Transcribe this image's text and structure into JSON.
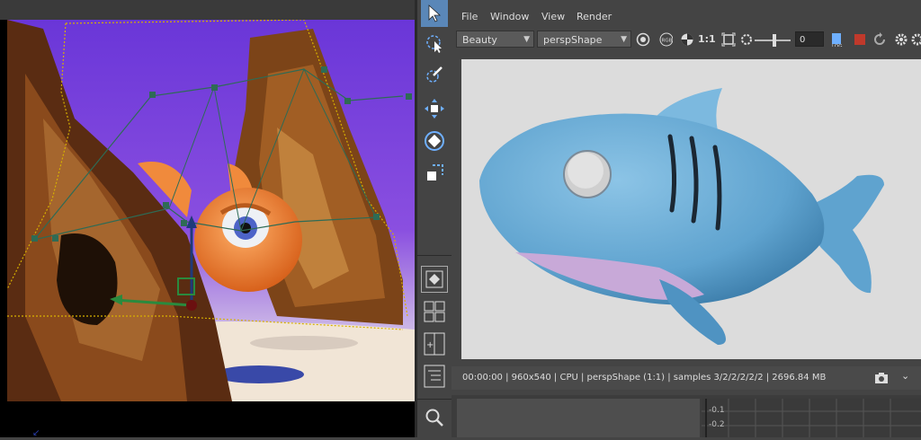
{
  "menu": {
    "file": "File",
    "window": "Window",
    "view": "View",
    "render": "Render"
  },
  "toolbar": {
    "aov_select": "Beauty",
    "camera_select": "perspShape",
    "ratio_label": "1:1",
    "exposure_value": "0"
  },
  "statusbar": {
    "text": "00:00:00 | 960x540 | CPU | perspShape (1:1) | samples 3/2/2/2/2/2 | 2696.84 MB"
  },
  "graph": {
    "tick_1": "-0.1",
    "tick_2": "-0.2"
  },
  "colors": {
    "accent_selected": "#5a87b8",
    "panel_bg": "#444444",
    "render_bg": "#dcdcdc",
    "shark_blue": "#5fa3cf",
    "fish_orange": "#f08a3c",
    "scene_purple": "#7b3dd6"
  },
  "icons": [
    "select-tool-icon",
    "lasso-tool-icon",
    "paint-select-icon",
    "move-tool-icon",
    "rotate-tool-icon",
    "scale-tool-icon",
    "single-layout-icon",
    "four-layout-icon",
    "two-layout-icon",
    "outliner-layout-icon",
    "search-icon",
    "refresh-icon",
    "rgb-icon",
    "channel-icon",
    "region-icon",
    "ipr-icon",
    "log-icon",
    "stop-icon",
    "rerender-icon",
    "settings-icon",
    "snapshot-icon",
    "chevron-down-icon"
  ]
}
